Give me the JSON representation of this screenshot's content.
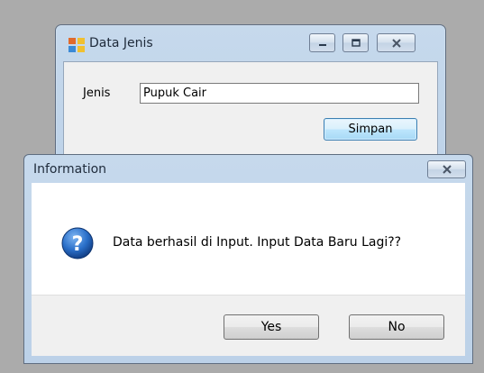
{
  "back_window": {
    "title": "Data Jenis",
    "icon": "app-form-icon",
    "caption_buttons": [
      "minimize-icon",
      "maximize-icon",
      "close-icon"
    ],
    "form": {
      "label": "Jenis",
      "value": "Pupuk Cair",
      "save_label": "Simpan"
    }
  },
  "dialog": {
    "title": "Information",
    "icon": "question-icon",
    "message": "Data berhasil di Input. Input Data Baru Lagi??",
    "yes_label": "Yes",
    "no_label": "No"
  },
  "colors": {
    "frame": "#c6d9ec",
    "client": "#f0f0f0",
    "icon_blue": "#1d5fb5"
  }
}
